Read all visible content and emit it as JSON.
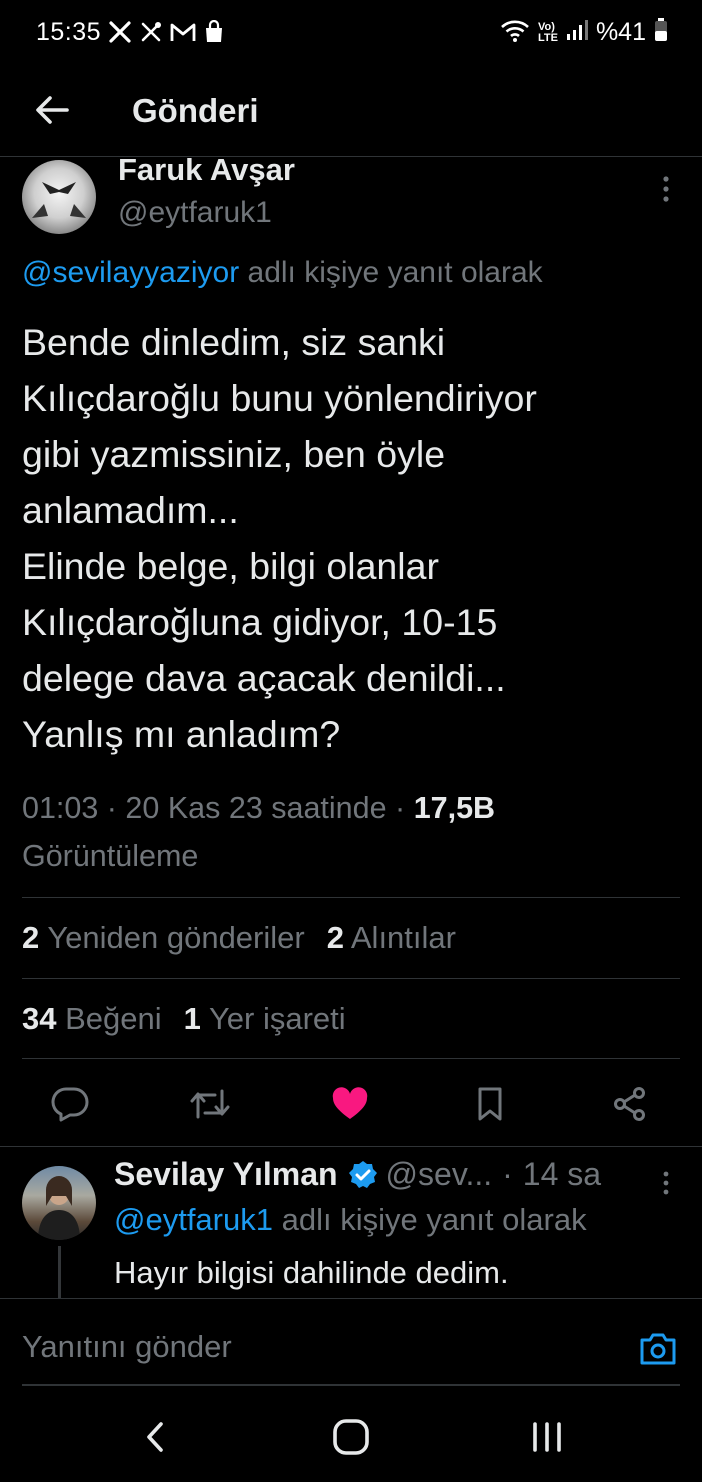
{
  "status_bar": {
    "time": "15:35",
    "battery": "%41",
    "icons": [
      "x-app-icon",
      "tool-icon",
      "gmail-icon",
      "shopping-bag-icon",
      "wifi-icon",
      "volte-icon",
      "signal-icon",
      "battery-icon"
    ],
    "volte_top": "Vo)",
    "volte_bottom": "LTE"
  },
  "header": {
    "title": "Gönderi"
  },
  "tweet": {
    "author_name": "Faruk Avşar",
    "author_handle": "@eytfaruk1",
    "reply_mention": "@sevilayyaziyor",
    "reply_suffix": " adlı kişiye yanıt olarak",
    "body": "Bende dinledim, siz sanki\nKılıçdaroğlu bunu yönlendiriyor\ngibi yazmissiniz, ben öyle\nanlamadım...\nElinde belge, bilgi olanlar\nKılıçdaroğluna gidiyor, 10-15\ndelege dava açacak denildi...\nYanlış mı anladım?",
    "timestamp": "01:03 · 20 Kas 23 saatinde · ",
    "views_count": "17,5B",
    "views_label": "Görüntüleme",
    "reposts_count": "2",
    "reposts_label": "Yeniden gönderiler",
    "quotes_count": "2",
    "quotes_label": "Alıntılar",
    "likes_count": "34",
    "likes_label": "Beğeni",
    "bookmarks_count": "1",
    "bookmarks_label": "Yer işareti"
  },
  "actions": [
    "reply-icon",
    "repost-icon",
    "like-icon",
    "bookmark-icon",
    "share-icon"
  ],
  "colors": {
    "background": "#000000",
    "text_primary": "#e7e9ea",
    "text_secondary": "#71767b",
    "accent_blue": "#1d9bf0",
    "like_pink": "#f91880",
    "divider": "#2f3336"
  },
  "reply": {
    "author_name": "Sevilay Yılman",
    "author_handle": "@sev...",
    "time": "14 sa",
    "reply_mention": "@eytfaruk1",
    "reply_suffix": " adlı kişiye yanıt olarak",
    "text": "Hayır bilgisi dahilinde dedim."
  },
  "composer": {
    "placeholder": "Yanıtını gönder"
  },
  "nav": [
    "back-nav-icon",
    "home-nav-icon",
    "recents-nav-icon"
  ]
}
